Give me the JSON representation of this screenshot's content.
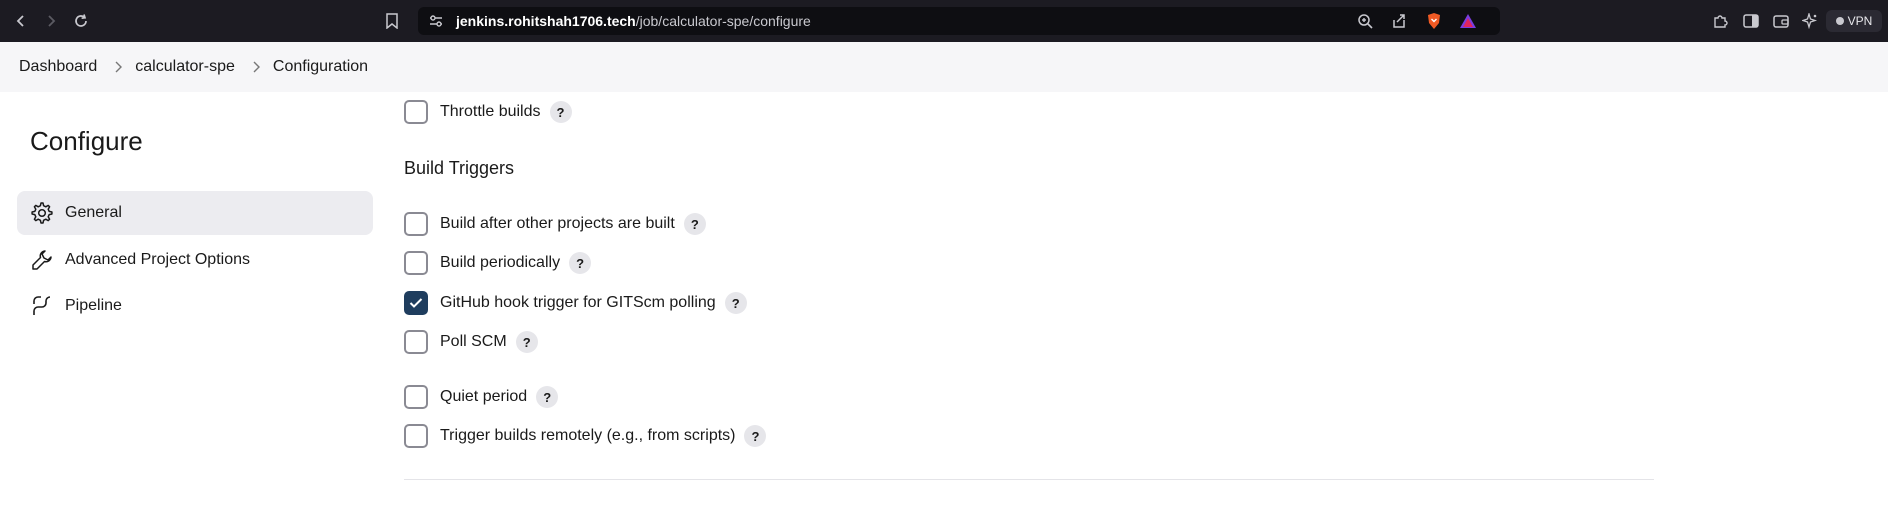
{
  "browser": {
    "url_host": "jenkins.rohitshah1706.tech",
    "url_path": "/job/calculator-spe/configure",
    "vpn_label": "VPN",
    "icons": [
      "back-icon",
      "forward-icon",
      "reload-icon",
      "bookmark-icon",
      "site-settings-icon",
      "zoom-icon",
      "share-icon",
      "brave-shields-icon",
      "brave-rewards-icon",
      "extensions-icon",
      "sidebar-icon",
      "wallet-icon",
      "leo-ai-icon"
    ]
  },
  "breadcrumb": {
    "items": [
      "Dashboard",
      "calculator-spe",
      "Configuration"
    ]
  },
  "sidebar": {
    "title": "Configure",
    "items": [
      {
        "label": "General",
        "icon": "gear-icon",
        "active": true
      },
      {
        "label": "Advanced Project Options",
        "icon": "wrench-icon",
        "active": false
      },
      {
        "label": "Pipeline",
        "icon": "pipeline-icon",
        "active": false
      }
    ]
  },
  "main": {
    "throttle": {
      "label": "Throttle builds",
      "checked": false
    },
    "build_triggers": {
      "title": "Build Triggers",
      "options": [
        {
          "label": "Build after other projects are built",
          "checked": false
        },
        {
          "label": "Build periodically",
          "checked": false
        },
        {
          "label": "GitHub hook trigger for GITScm polling",
          "checked": true
        },
        {
          "label": "Poll SCM",
          "checked": false
        },
        {
          "label": "Quiet period",
          "checked": false
        },
        {
          "label": "Trigger builds remotely (e.g., from scripts)",
          "checked": false
        }
      ]
    },
    "help_label": "?"
  },
  "colors": {
    "chrome_bg": "#1c1b22",
    "checked_box": "#1f3d5e",
    "active_nav": "#ececf0"
  }
}
